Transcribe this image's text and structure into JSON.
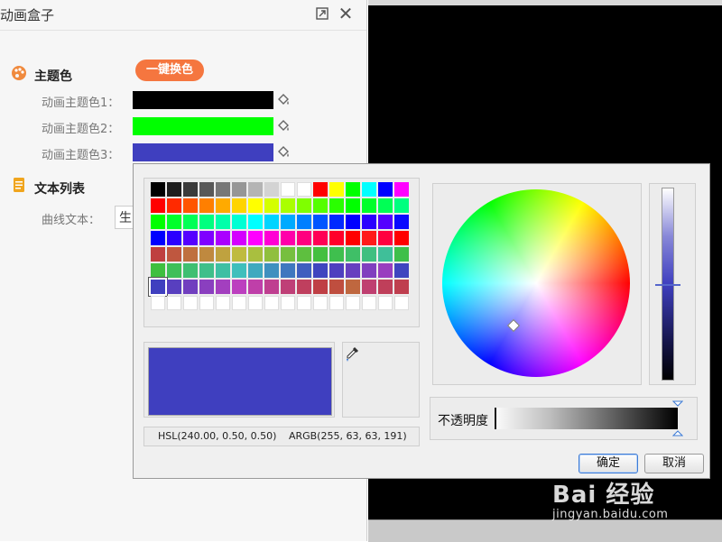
{
  "panel": {
    "title": "动画盒子",
    "sections": {
      "theme": {
        "title": "主题色",
        "one_key_button": "一键换色",
        "colors": [
          {
            "label": "动画主题色1：",
            "value": "#000000"
          },
          {
            "label": "动画主题色2：",
            "value": "#00ff00"
          },
          {
            "label": "动画主题色3：",
            "value": "#3f3fbf"
          }
        ]
      },
      "text_list": {
        "title": "文本列表",
        "curve_label": "曲线文本：",
        "curve_value": "生"
      }
    }
  },
  "dialog": {
    "palette_rows": [
      [
        "#000000",
        "#1e1e1e",
        "#3a3a3a",
        "#585858",
        "#777777",
        "#969696",
        "#b4b4b4",
        "#d3d3d3",
        "#ffffff",
        "#ffffff",
        "#ff0000",
        "#ffff00",
        "#00ff00",
        "#00ffff",
        "#0000ff",
        "#ff00ff"
      ],
      [
        "#ff0000",
        "#ff2a00",
        "#ff5500",
        "#ff7f00",
        "#ffaa00",
        "#ffd400",
        "#ffff00",
        "#d4ff00",
        "#aaff00",
        "#7fff00",
        "#55ff00",
        "#2aff00",
        "#00ff00",
        "#00ff2a",
        "#00ff55",
        "#00ff7f"
      ],
      [
        "#00ff00",
        "#00ff2a",
        "#00ff55",
        "#00ff7f",
        "#00ffaa",
        "#00ffd4",
        "#00ffff",
        "#00d4ff",
        "#00aaff",
        "#007fff",
        "#0055ff",
        "#002aff",
        "#0000ff",
        "#2a00ff",
        "#5500ff",
        "#0a0aff"
      ],
      [
        "#0000ff",
        "#2a00ff",
        "#5500ff",
        "#7f00ff",
        "#aa00ff",
        "#d400ff",
        "#ff00ff",
        "#ff00d4",
        "#ff00aa",
        "#ff007f",
        "#ff0055",
        "#ff002a",
        "#ff0000",
        "#ff1a1a",
        "#ff0040",
        "#ff0000"
      ],
      [
        "#bf3f3f",
        "#bf573f",
        "#bf703f",
        "#bf893f",
        "#bfa23f",
        "#bfbb3f",
        "#a9bf3f",
        "#90bf3f",
        "#77bf3f",
        "#5ebf3f",
        "#45bf3f",
        "#3fbf4e",
        "#3fbf67",
        "#3fbf80",
        "#3fbf99",
        "#3fbf4a"
      ],
      [
        "#3fbf3f",
        "#3fbf58",
        "#3fbf71",
        "#3fbf8a",
        "#3fbfa3",
        "#3fbfbc",
        "#3fa9bf",
        "#3f90bf",
        "#3f77bf",
        "#3f5ebf",
        "#3f45bf",
        "#4e3fbf",
        "#673fbf",
        "#803fbf",
        "#993fbf",
        "#3f45bf"
      ],
      [
        "#3f3fbf",
        "#583fbf",
        "#713fbf",
        "#8a3fbf",
        "#a33fbf",
        "#bc3fbf",
        "#bf3fa9",
        "#bf3f90",
        "#bf3f77",
        "#bf3f5e",
        "#bf3f45",
        "#bf4e3f",
        "#bf673f",
        "#bf3f70",
        "#bf3f5a",
        "#bf3f4f"
      ],
      [
        "#ffffff",
        "#ffffff",
        "#ffffff",
        "#ffffff",
        "#ffffff",
        "#ffffff",
        "#ffffff",
        "#ffffff",
        "#ffffff",
        "#ffffff",
        "#ffffff",
        "#ffffff",
        "#ffffff",
        "#ffffff",
        "#ffffff",
        "#ffffff"
      ]
    ],
    "selected_cell": {
      "row": 6,
      "col": 0
    },
    "current_color": "#3f3fbf",
    "hsl_text": "HSL(240.00, 0.50, 0.50)",
    "argb_text": "ARGB(255, 63, 63, 191)",
    "opacity_label": "不透明度",
    "ok_label": "确定",
    "cancel_label": "取消"
  },
  "watermark": {
    "brand": "Bai 经验",
    "url": "jingyan.baidu.com"
  },
  "icons": {
    "restore": "restore-icon",
    "close": "close-icon",
    "palette": "palette-icon",
    "document": "document-icon",
    "paint_bucket": "paint-bucket-icon",
    "eyedropper": "eyedropper-icon"
  }
}
